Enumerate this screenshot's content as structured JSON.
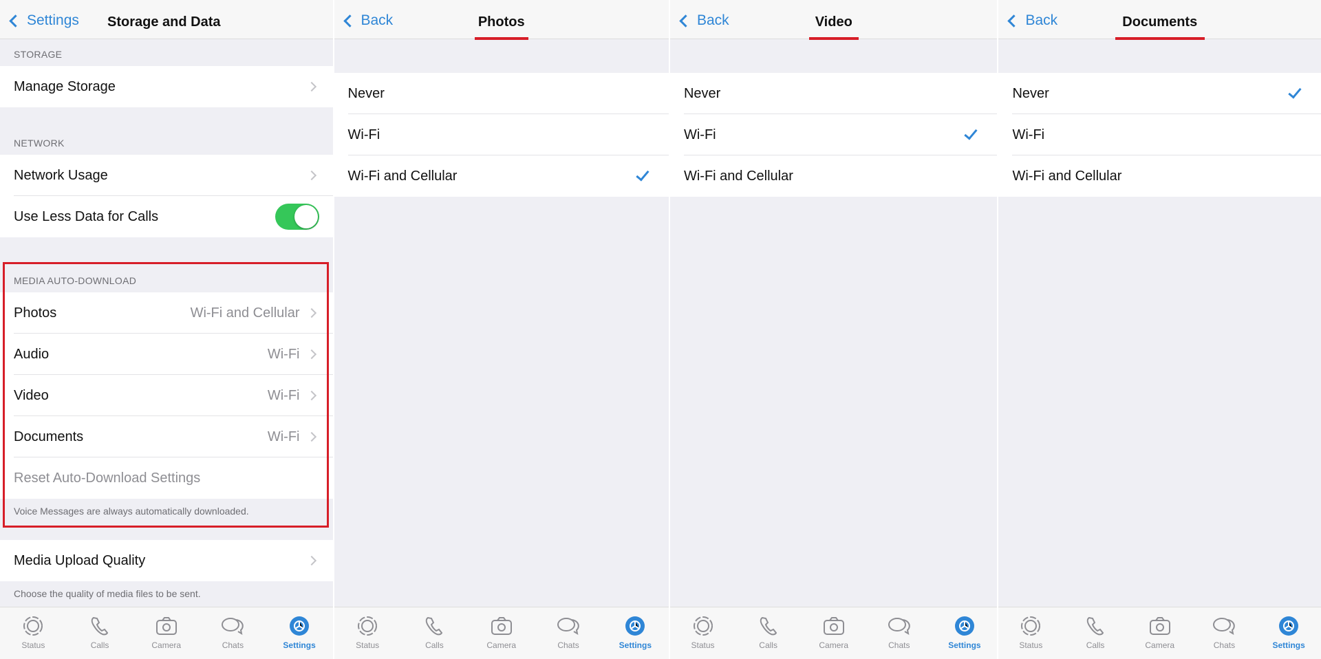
{
  "colors": {
    "accent": "#2f86d6",
    "toggle_on": "#35c759",
    "highlight": "#d71e28"
  },
  "storage_panel": {
    "back": "Settings",
    "title": "Storage and Data",
    "storage_header": "STORAGE",
    "manage_storage": "Manage Storage",
    "network_header": "NETWORK",
    "network_usage": "Network Usage",
    "less_data": "Use Less Data for Calls",
    "less_data_on": true,
    "media_header": "MEDIA AUTO-DOWNLOAD",
    "media_items": [
      {
        "label": "Photos",
        "value": "Wi-Fi and Cellular"
      },
      {
        "label": "Audio",
        "value": "Wi-Fi"
      },
      {
        "label": "Video",
        "value": "Wi-Fi"
      },
      {
        "label": "Documents",
        "value": "Wi-Fi"
      }
    ],
    "reset": "Reset Auto-Download Settings",
    "media_footer": "Voice Messages are always automatically downloaded.",
    "upload_quality": "Media Upload Quality",
    "upload_footer": "Choose the quality of media files to be sent."
  },
  "photos_panel": {
    "back": "Back",
    "title": "Photos",
    "options": [
      "Never",
      "Wi-Fi",
      "Wi-Fi and Cellular"
    ],
    "selected": "Wi-Fi and Cellular"
  },
  "video_panel": {
    "back": "Back",
    "title": "Video",
    "options": [
      "Never",
      "Wi-Fi",
      "Wi-Fi and Cellular"
    ],
    "selected": "Wi-Fi"
  },
  "documents_panel": {
    "back": "Back",
    "title": "Documents",
    "options": [
      "Never",
      "Wi-Fi",
      "Wi-Fi and Cellular"
    ],
    "selected": "Never"
  },
  "tabbar": {
    "items": [
      {
        "label": "Status",
        "icon": "status-icon"
      },
      {
        "label": "Calls",
        "icon": "phone-icon"
      },
      {
        "label": "Camera",
        "icon": "camera-icon"
      },
      {
        "label": "Chats",
        "icon": "chat-bubbles-icon"
      },
      {
        "label": "Settings",
        "icon": "gear-icon"
      }
    ],
    "active": "Settings"
  }
}
